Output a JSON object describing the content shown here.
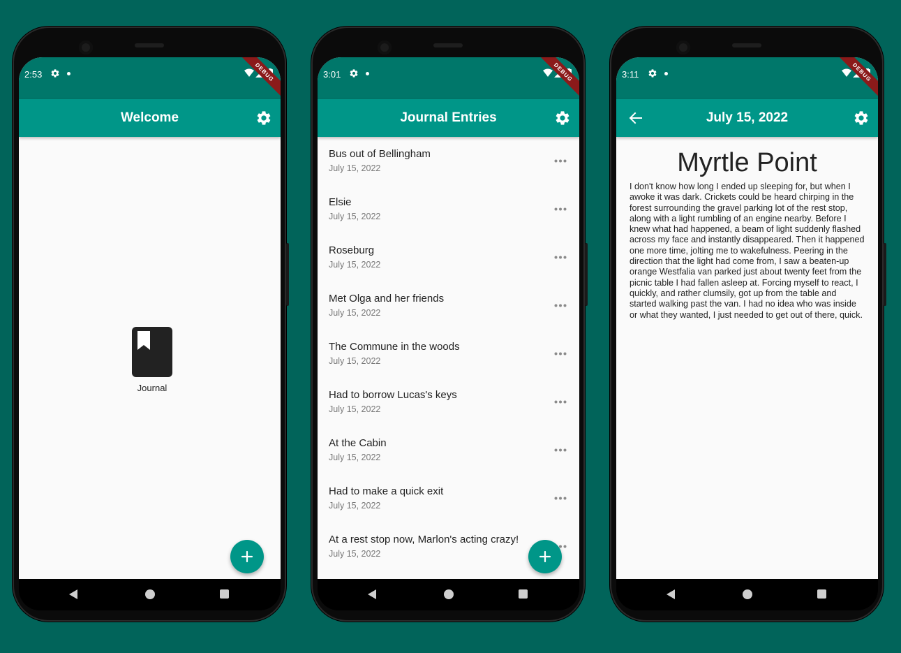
{
  "colors": {
    "background": "#01645a",
    "status_bar": "#00776a",
    "app_bar": "#009688",
    "accent": "#009688",
    "debug_banner": "#8b1a1a"
  },
  "debug_banner": "DEBUG",
  "phones": [
    {
      "status_time": "2:53",
      "app_bar_title": "Welcome",
      "journal_label": "Journal",
      "icons": [
        "settings-icon",
        "book-icon",
        "add-icon"
      ]
    },
    {
      "status_time": "3:01",
      "app_bar_title": "Journal Entries",
      "entries": [
        {
          "title": "Bus out of Bellingham",
          "date": "July 15, 2022"
        },
        {
          "title": "Elsie",
          "date": "July 15, 2022"
        },
        {
          "title": "Roseburg",
          "date": "July 15, 2022"
        },
        {
          "title": "Met Olga and her friends",
          "date": "July 15, 2022"
        },
        {
          "title": "The Commune in the woods",
          "date": "July 15, 2022"
        },
        {
          "title": "Had to borrow Lucas's keys",
          "date": "July 15, 2022"
        },
        {
          "title": "At the Cabin",
          "date": "July 15, 2022"
        },
        {
          "title": "Had to make a quick exit",
          "date": "July 15, 2022"
        },
        {
          "title": "At a rest stop now, Marlon's acting crazy!",
          "date": "July 15, 2022"
        }
      ]
    },
    {
      "status_time": "3:11",
      "app_bar_title": "July 15, 2022",
      "entry_title": "Myrtle Point",
      "entry_body": "I don't know how long I ended up sleeping for, but when I awoke it was dark. Crickets could be heard chirping in the forest surrounding the gravel parking lot of the rest stop, along with a light rumbling of an engine nearby. Before I knew what had happened, a beam of light suddenly flashed across my face and instantly disappeared. Then it happened one more time, jolting me to wakefulness. Peering in the direction that the light had come from, I saw a beaten-up orange Westfalia van parked just about twenty feet from the picnic table I had fallen asleep at. Forcing myself to react, I quickly, and rather clumsily, got up from the table and started walking past the van. I had no idea who was inside or what they wanted, I just needed to get out of there, quick."
    }
  ]
}
